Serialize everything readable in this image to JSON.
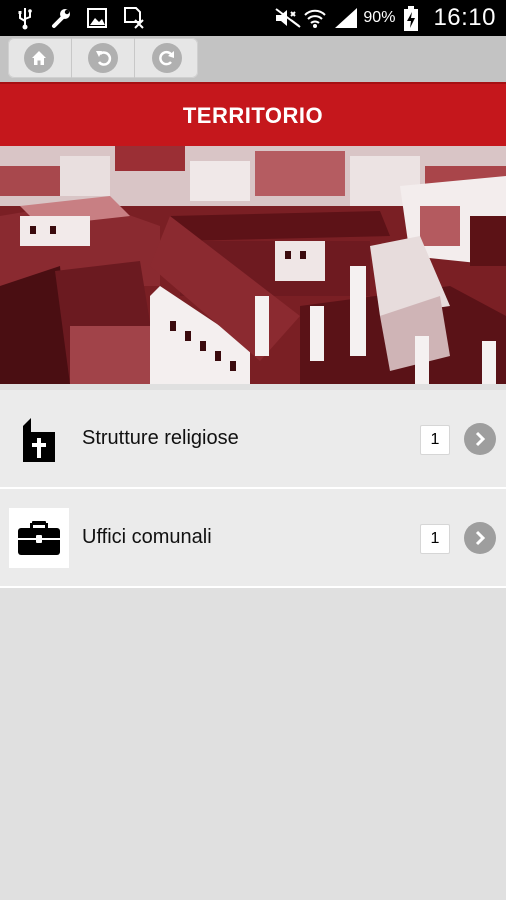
{
  "status_bar": {
    "battery_percent": "90%",
    "time": "16:10",
    "left_icons": [
      "usb-icon",
      "wrench-icon",
      "image-icon",
      "no-sim-icon"
    ],
    "right_icons": [
      "mute-icon",
      "wifi-icon",
      "signal-icon",
      "battery-charging-icon"
    ]
  },
  "toolbar": {
    "buttons": [
      "home-icon",
      "back-icon",
      "refresh-icon"
    ]
  },
  "header": {
    "title": "TERRITORIO"
  },
  "list": {
    "items": [
      {
        "label": "Strutture religiose",
        "count": "1",
        "icon": "church-icon"
      },
      {
        "label": "Uffici comunali",
        "count": "1",
        "icon": "briefcase-icon"
      }
    ]
  },
  "colors": {
    "accent": "#c5171c",
    "background": "#e0e0e0",
    "row_background": "#ebebeb",
    "toolbar": "#c3c3c3"
  }
}
